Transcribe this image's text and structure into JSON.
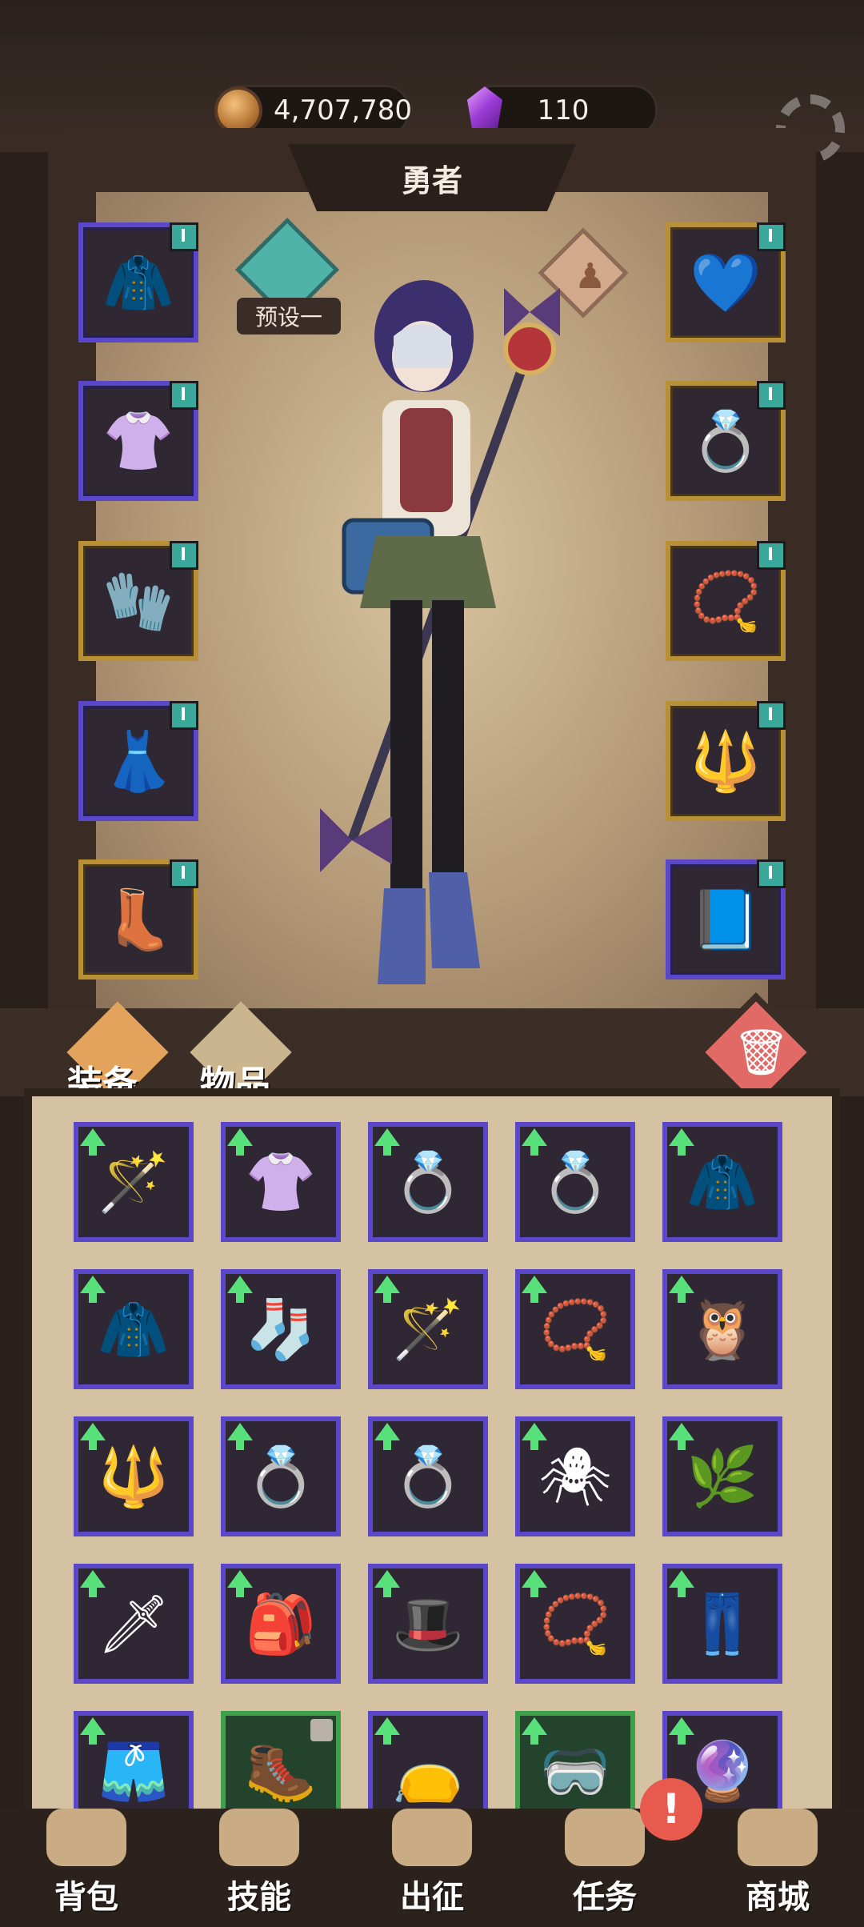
{
  "header": {
    "gold_amount": "4,707,780",
    "gem_amount": "110",
    "title": "勇者"
  },
  "preset": {
    "label": "预设一"
  },
  "tabs": {
    "equipment": "装备",
    "items": "物品"
  },
  "equipped_left": [
    {
      "icon": "hood-icon",
      "has_badge": true
    },
    {
      "icon": "vest-icon",
      "has_badge": true
    },
    {
      "icon": "gloves-icon",
      "has_badge": true
    },
    {
      "icon": "skirt-icon",
      "has_badge": true
    },
    {
      "icon": "boots-icon",
      "has_badge": true
    }
  ],
  "equipped_right": [
    {
      "icon": "heart-necklace-icon",
      "has_badge": true
    },
    {
      "icon": "ring-icon",
      "has_badge": true
    },
    {
      "icon": "bracelet-icon",
      "has_badge": true
    },
    {
      "icon": "staff-icon",
      "has_badge": true
    },
    {
      "icon": "book-icon",
      "has_badge": true
    }
  ],
  "inventory": [
    {
      "icon": "wand-icon",
      "rarity": "purple",
      "upgrade": true
    },
    {
      "icon": "vest-icon",
      "rarity": "purple",
      "upgrade": true
    },
    {
      "icon": "star-ring-icon",
      "rarity": "purple",
      "upgrade": true
    },
    {
      "icon": "star-ring-icon",
      "rarity": "purple",
      "upgrade": true
    },
    {
      "icon": "coat-icon",
      "rarity": "purple",
      "upgrade": true
    },
    {
      "icon": "hood-icon",
      "rarity": "purple",
      "upgrade": true
    },
    {
      "icon": "sleeve-icon",
      "rarity": "purple",
      "upgrade": true
    },
    {
      "icon": "wand-icon",
      "rarity": "purple",
      "upgrade": true
    },
    {
      "icon": "amulet-icon",
      "rarity": "purple",
      "upgrade": true
    },
    {
      "icon": "owl-bracelet-icon",
      "rarity": "purple",
      "upgrade": true
    },
    {
      "icon": "staff-icon",
      "rarity": "purple",
      "upgrade": true
    },
    {
      "icon": "star-ring-icon",
      "rarity": "purple",
      "upgrade": true
    },
    {
      "icon": "ruby-ring-icon",
      "rarity": "purple",
      "upgrade": true
    },
    {
      "icon": "spider-amulet-icon",
      "rarity": "purple",
      "upgrade": true
    },
    {
      "icon": "branch-staff-icon",
      "rarity": "purple",
      "upgrade": true
    },
    {
      "icon": "spear-icon",
      "rarity": "purple",
      "upgrade": true
    },
    {
      "icon": "backpack-icon",
      "rarity": "purple",
      "upgrade": true
    },
    {
      "icon": "witch-hat-icon",
      "rarity": "purple",
      "upgrade": true
    },
    {
      "icon": "amulet-icon",
      "rarity": "purple",
      "upgrade": true
    },
    {
      "icon": "pants-icon",
      "rarity": "purple",
      "upgrade": true
    },
    {
      "icon": "shorts-icon",
      "rarity": "purple",
      "upgrade": true
    },
    {
      "icon": "armored-boots-icon",
      "rarity": "green",
      "upgrade": false,
      "locked": true
    },
    {
      "icon": "belt-icon",
      "rarity": "purple",
      "upgrade": true
    },
    {
      "icon": "goggles-icon",
      "rarity": "green",
      "upgrade": true
    },
    {
      "icon": "pendant-icon",
      "rarity": "purple",
      "upgrade": true
    }
  ],
  "nav": [
    {
      "label": "背包",
      "icon": "backpack-icon"
    },
    {
      "label": "技能",
      "icon": "skill-card-icon"
    },
    {
      "label": "出征",
      "icon": "battle-scroll-icon"
    },
    {
      "label": "任务",
      "icon": "quest-horn-icon"
    },
    {
      "label": "商城",
      "icon": "shop-crown-icon"
    }
  ],
  "alert_mark": "!",
  "colors": {
    "purple_rarity": "#5a47c9",
    "gold_rarity": "#b99036",
    "green_rarity": "#3ea14a",
    "upgrade_arrow": "#58e07a",
    "trash": "#e26a66",
    "alert": "#e85a4e"
  }
}
